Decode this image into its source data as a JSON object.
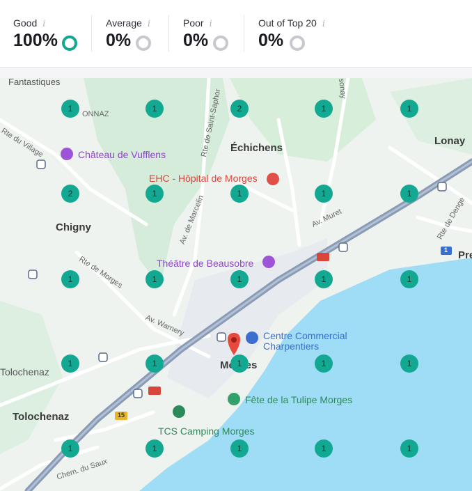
{
  "stats": [
    {
      "label": "Good",
      "value": "100%",
      "ring": "good"
    },
    {
      "label": "Average",
      "value": "0%",
      "ring": "empty"
    },
    {
      "label": "Poor",
      "value": "0%",
      "ring": "empty"
    },
    {
      "label": "Out of Top 20",
      "value": "0%",
      "ring": "empty"
    }
  ],
  "info_glyph": "i",
  "colors": {
    "good": "#13a891",
    "empty": "#c8c8d0",
    "water": "#9fdcf6",
    "land": "#eaf2ec",
    "highway": "#8a9bb5"
  },
  "grid": {
    "rows": [
      [
        "1",
        "1",
        "2",
        "1",
        "1"
      ],
      [
        "2",
        "1",
        "1",
        "1",
        "1"
      ],
      [
        "1",
        "1",
        "1",
        "1",
        "1"
      ],
      [
        "1",
        "1",
        "1",
        "1",
        "1"
      ],
      [
        "1",
        "1",
        "1",
        "1",
        "1"
      ]
    ]
  },
  "map_labels": {
    "fantastiques": "Fantastiques",
    "onnaz": "ONNAZ",
    "rte_village": "Rte du Village",
    "chateau": "Château de Vufflens",
    "rte_saint_saphorin": "Rte de Saint-Saphor",
    "echichens": "Échichens",
    "lonay": "Lonay",
    "ehc": "EHC - Hôpital de Morges",
    "chigny": "Chigny",
    "av_marcelin": "Av. de Marcelin",
    "av_muret": "Av. Muret",
    "rte_denges": "Rte de Denge",
    "pre": "Pre",
    "rte_morges": "Rte de Morges",
    "theatre": "Théâtre de Beausobre",
    "av_warnery": "Av. Warnery",
    "centre_1": "Centre Commercial",
    "centre_2": "Charpentiers",
    "tolochenaz_1": "Tolochenaz",
    "morges": "Morges",
    "tulipe": "Fête de la Tulipe Morges",
    "tolochenaz_2": "Tolochenaz",
    "tcs": "TCS Camping Morges",
    "chem_saux": "Chem. du Saux",
    "sonay": "sonay",
    "road_15": "15",
    "road_1": "1"
  }
}
